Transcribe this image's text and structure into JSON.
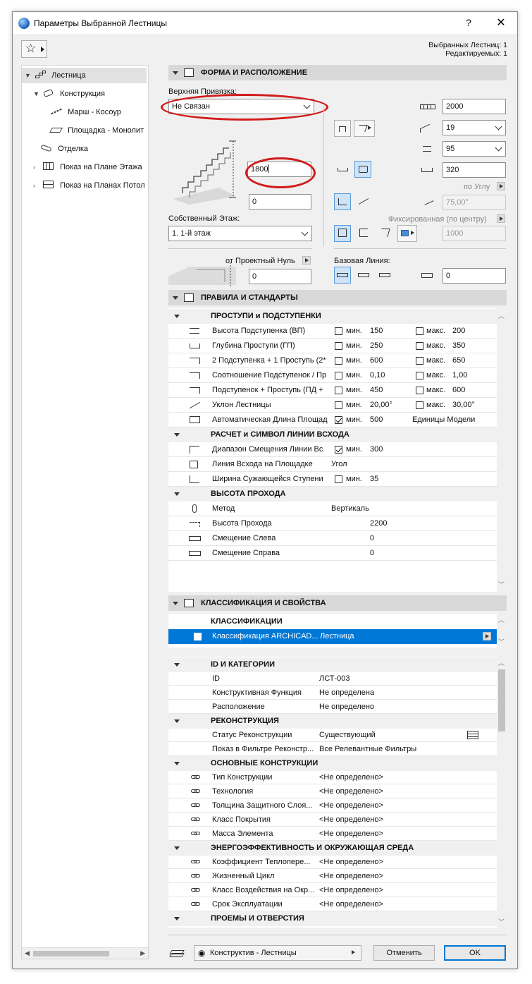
{
  "window": {
    "title": "Параметры Выбранной Лестницы",
    "help": "?",
    "close": "✕"
  },
  "selection_info": {
    "selected": "Выбранных Лестниц: 1",
    "editable": "Редактируемых: 1"
  },
  "tree": {
    "items": [
      {
        "label": "Лестница"
      },
      {
        "label": "Конструкция"
      },
      {
        "label": "Марш - Косоур"
      },
      {
        "label": "Площадка - Монолит"
      },
      {
        "label": "Отделка"
      },
      {
        "label": "Показ на Плане Этажа"
      },
      {
        "label": "Показ на Планах Потол"
      }
    ]
  },
  "form": {
    "section_title": "ФОРМА И РАСПОЛОЖЕНИЕ",
    "top_link_label": "Верхняя Привязка:",
    "top_link_value": "Не Связан",
    "height_value": "1800",
    "bottom_offset_value": "0",
    "home_story_label": "Собственный Этаж:",
    "home_story_value": "1. 1-й этаж",
    "from_zero_label": "от Проектный Нуль",
    "from_zero_value": "0",
    "total_width_value": "2000",
    "risers_value": "19",
    "riser_height_value": "95",
    "going_value": "320",
    "by_angle_label": "по Углу",
    "angle_value": "75,00°",
    "fixed_label": "Фиксированная (по центру)",
    "fixed_value": "1000",
    "baseline_label": "Базовая Линия:",
    "baseline_offset_value": "0"
  },
  "rules": {
    "section_title": "ПРАВИЛА И СТАНДАРТЫ",
    "min_label": "мин.",
    "max_label": "макс.",
    "groups": {
      "treads": "ПРОСТУПИ и ПОДСТУПЕНКИ",
      "walkline": "РАСЧЕТ и СИМВОЛ ЛИНИИ ВСХОДА",
      "headroom": "ВЫСОТА ПРОХОДА"
    },
    "rows": [
      {
        "name": "Высота Подступенка (ВП)",
        "min": "150",
        "max": "200"
      },
      {
        "name": "Глубина Проступи (ГП)",
        "min": "250",
        "max": "350"
      },
      {
        "name": "2 Подступенка + 1 Проступь (2*",
        "min": "600",
        "max": "650"
      },
      {
        "name": "Соотношение Подступенок / Пр",
        "min": "0,10",
        "max": "1,00"
      },
      {
        "name": "Подступенок + Проступь (ПД +",
        "min": "450",
        "max": "600"
      },
      {
        "name": "Уклон Лестницы",
        "min": "20,00°",
        "max": "30,00°"
      },
      {
        "name": "Автоматическая Длина Площад",
        "min": "500",
        "extra": "Единицы Модели"
      }
    ],
    "walk_rows": [
      {
        "name": "Диапазон Смещения Линии Вс",
        "min": "300"
      },
      {
        "name": "Линия Всхода на Площадке",
        "value": "Угол"
      },
      {
        "name": "Ширина Сужающейся Ступени",
        "min": "35"
      }
    ],
    "head_rows": [
      {
        "name": "Метод",
        "value": "Вертикаль"
      },
      {
        "name": "Высота Прохода",
        "value": "2200"
      },
      {
        "name": "Смещение Слева",
        "value": "0"
      },
      {
        "name": "Смещение Справа",
        "value": "0"
      }
    ]
  },
  "classification": {
    "section_title": "КЛАССИФИКАЦИЯ И СВОЙСТВА",
    "group_title": "КЛАССИФИКАЦИИ",
    "row_name": "Классификация ARCHICAD...",
    "row_value": "Лестница"
  },
  "properties": {
    "groups": [
      {
        "title": "ID И КАТЕГОРИИ",
        "rows": [
          {
            "name": "ID",
            "value": "ЛСТ-003"
          },
          {
            "name": "Конструктивная Функция",
            "value": "Не определена"
          },
          {
            "name": "Расположение",
            "value": "Не определено"
          }
        ]
      },
      {
        "title": "РЕКОНСТРУКЦИЯ",
        "rows": [
          {
            "name": "Статус Реконструкции",
            "value": "Существующий"
          },
          {
            "name": "Показ в Фильтре Реконстр...",
            "value": "Все Релевантные Фильтры"
          }
        ]
      },
      {
        "title": "ОСНОВНЫЕ КОНСТРУКЦИИ",
        "rows": [
          {
            "name": "Тип Конструкции",
            "value": "<Не определено>"
          },
          {
            "name": "Технология",
            "value": "<Не определено>"
          },
          {
            "name": "Толщина Защитного Слоя...",
            "value": "<Не определено>"
          },
          {
            "name": "Класс Покрытия",
            "value": "<Не определено>"
          },
          {
            "name": "Масса Элемента",
            "value": "<Не определено>"
          }
        ]
      },
      {
        "title": "ЭНЕРГОЭФФЕКТИВНОСТЬ И ОКРУЖАЮЩАЯ СРЕДА",
        "rows": [
          {
            "name": "Коэффициент Теплопере...",
            "value": "<Не определено>"
          },
          {
            "name": "Жизненный Цикл",
            "value": "<Не определено>"
          },
          {
            "name": "Класс Воздействия на Окр...",
            "value": "<Не определено>"
          },
          {
            "name": "Срок Эксплуатации",
            "value": "<Не определено>"
          }
        ]
      },
      {
        "title": "ПРОЕМЫ И ОТВЕРСТИЯ",
        "rows": []
      }
    ]
  },
  "footer": {
    "layer_value": "Конструктив - Лестницы",
    "cancel": "Отменить",
    "ok": "OK"
  }
}
